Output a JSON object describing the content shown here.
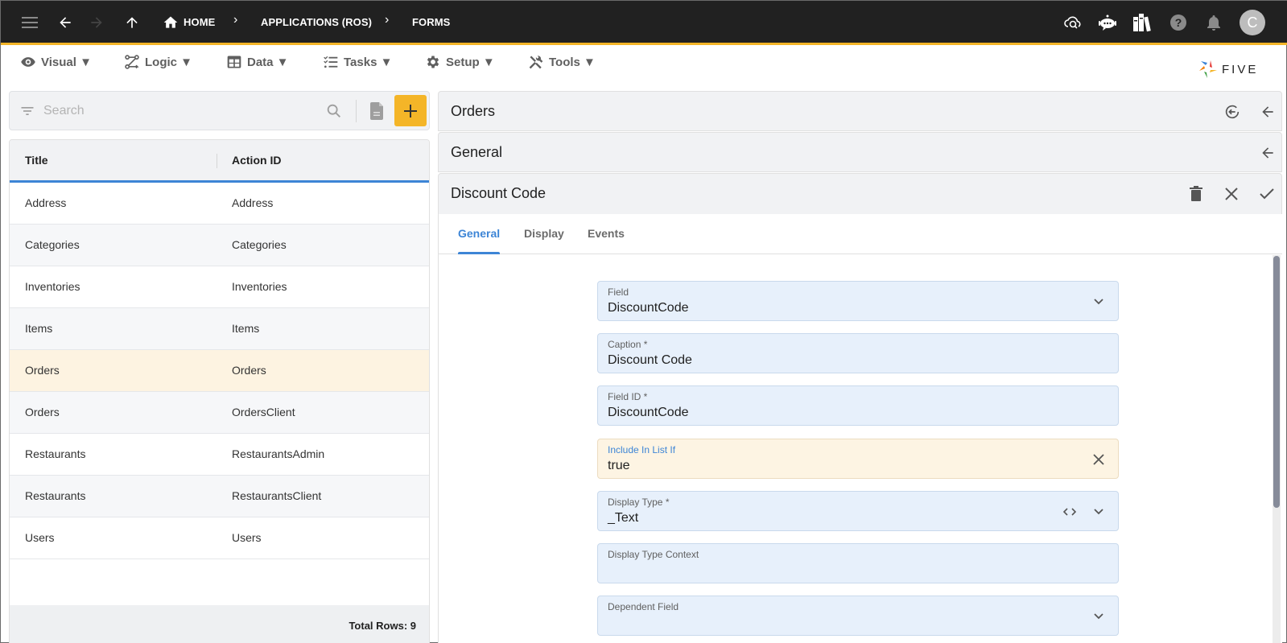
{
  "topbar": {
    "breadcrumbs": [
      "HOME",
      "APPLICATIONS (ROS)",
      "FORMS"
    ],
    "avatar_initial": "C",
    "icons": [
      "menu-icon",
      "back-arrow-icon",
      "forward-arrow-icon",
      "up-arrow-icon",
      "home-icon",
      "cloud-search-icon",
      "chat-bot-icon",
      "library-books-icon",
      "help-icon",
      "notification-bell-icon"
    ]
  },
  "menubar": {
    "items": [
      {
        "label": "Visual ▼",
        "icon": "eye-icon"
      },
      {
        "label": "Logic ▼",
        "icon": "logic-flow-icon"
      },
      {
        "label": "Data ▼",
        "icon": "table-grid-icon"
      },
      {
        "label": "Tasks ▼",
        "icon": "checklist-icon"
      },
      {
        "label": "Setup ▼",
        "icon": "gear-icon"
      },
      {
        "label": "Tools ▼",
        "icon": "tools-icon"
      }
    ],
    "logo_text": "FIVE"
  },
  "list": {
    "search_placeholder": "Search",
    "columns": [
      "Title",
      "Action ID"
    ],
    "rows": [
      {
        "title": "Address",
        "action_id": "Address"
      },
      {
        "title": "Categories",
        "action_id": "Categories"
      },
      {
        "title": "Inventories",
        "action_id": "Inventories"
      },
      {
        "title": "Items",
        "action_id": "Items"
      },
      {
        "title": "Orders",
        "action_id": "Orders"
      },
      {
        "title": "Orders",
        "action_id": "OrdersClient"
      },
      {
        "title": "Restaurants",
        "action_id": "RestaurantsAdmin"
      },
      {
        "title": "Restaurants",
        "action_id": "RestaurantsClient"
      },
      {
        "title": "Users",
        "action_id": "Users"
      }
    ],
    "selected_index": 4,
    "total_rows": "Total Rows: 9"
  },
  "detail": {
    "panels": [
      {
        "title": "Orders"
      },
      {
        "title": "General"
      },
      {
        "title": "Discount Code"
      }
    ],
    "tabs": [
      {
        "label": "General",
        "active": true
      },
      {
        "label": "Display",
        "active": false
      },
      {
        "label": "Events",
        "active": false
      }
    ],
    "fields": [
      {
        "label": "Field",
        "value": "DiscountCode",
        "type": "select"
      },
      {
        "label": "Caption *",
        "value": "Discount Code",
        "type": "text"
      },
      {
        "label": "Field ID *",
        "value": "DiscountCode",
        "type": "text"
      },
      {
        "label": "Include In List If",
        "value": "true",
        "type": "clearable"
      },
      {
        "label": "Display Type *",
        "value": "_Text",
        "type": "select-code"
      },
      {
        "label": "Display Type Context",
        "value": "",
        "type": "text"
      },
      {
        "label": "Dependent Field",
        "value": "",
        "type": "select"
      }
    ]
  },
  "colors": {
    "accent": "#f4b528",
    "primary_blue": "#3d85d6",
    "topbar_bg": "#212121",
    "selected_row": "#fdf3e1",
    "field_bg": "#e7f0fb"
  }
}
